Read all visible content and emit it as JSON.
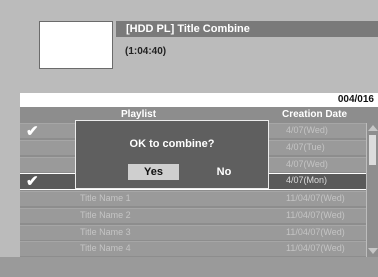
{
  "header": {
    "title": "[HDD PL] Title Combine",
    "duration": "(1:04:40)",
    "page_counter": "004/016"
  },
  "list": {
    "columns": {
      "playlist": "Playlist",
      "creation_date": "Creation Date"
    },
    "rows": [
      {
        "checked": true,
        "check_mark": "✔",
        "title": "",
        "date": "4/07(Wed)"
      },
      {
        "checked": false,
        "check_mark": "",
        "title": "",
        "date": "4/07(Tue)"
      },
      {
        "checked": false,
        "check_mark": "",
        "title": "",
        "date": "4/07(Wed)"
      },
      {
        "checked": true,
        "check_mark": "✔",
        "title": "",
        "date": "4/07(Mon)"
      },
      {
        "checked": false,
        "check_mark": "",
        "title": "Title Name 1",
        "date": "11/04/07(Wed)"
      },
      {
        "checked": false,
        "check_mark": "",
        "title": "Title Name 2",
        "date": "11/04/07(Wed)"
      },
      {
        "checked": false,
        "check_mark": "",
        "title": "Title Name 3",
        "date": "11/04/07(Wed)"
      },
      {
        "checked": false,
        "check_mark": "",
        "title": "Title Name 4",
        "date": "11/04/07(Wed)"
      }
    ]
  },
  "dialog": {
    "message": "OK to combine?",
    "yes_label": "Yes",
    "no_label": "No"
  },
  "icons": {
    "check": "check-icon",
    "scroll_up": "arrow-up-icon",
    "scroll_down": "arrow-down-icon"
  },
  "colors": {
    "background": "#bbbbbb",
    "list_bg": "#8d8d8d",
    "dialog_bg": "#5f5f5f",
    "selected_button": "#cfcfcf"
  }
}
